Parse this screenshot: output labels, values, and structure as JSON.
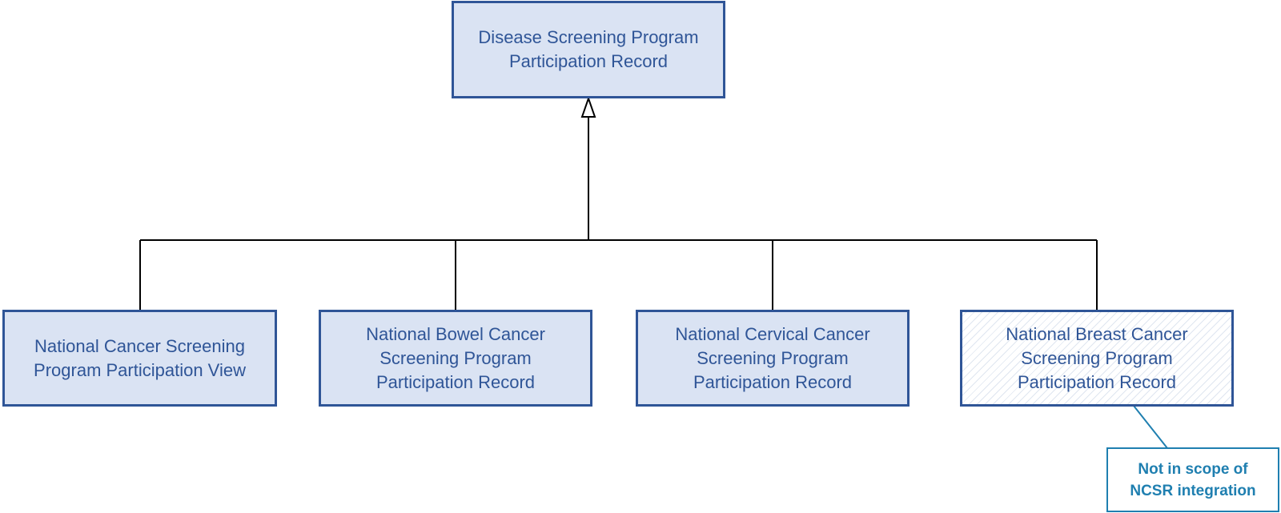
{
  "diagram": {
    "parent": {
      "line1": "Disease Screening Program",
      "line2": "Participation Record"
    },
    "children": [
      {
        "line1": "National Cancer Screening",
        "line2": "Program Participation View"
      },
      {
        "line1": "National Bowel Cancer",
        "line2": "Screening Program",
        "line3": "Participation Record"
      },
      {
        "line1": "National Cervical Cancer",
        "line2": "Screening Program",
        "line3": "Participation Record"
      },
      {
        "line1": "National Breast Cancer",
        "line2": "Screening Program",
        "line3": "Participation Record"
      }
    ],
    "note": {
      "line1": "Not in scope of",
      "line2": "NCSR integration"
    }
  },
  "colors": {
    "box_border": "#2f5597",
    "box_fill": "#dae3f3",
    "text": "#2f5597",
    "note_accent": "#1f7fb0",
    "connector": "#000000"
  }
}
